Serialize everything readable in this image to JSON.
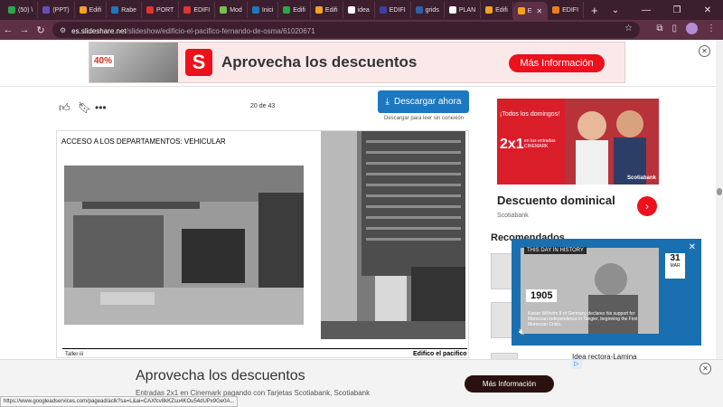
{
  "browser": {
    "tabs": [
      {
        "label": "(50) \\",
        "color": "#2aa84a"
      },
      {
        "label": "(PPT)",
        "color": "#6a4cc2"
      },
      {
        "label": "Edifi",
        "color": "#f2a31d"
      },
      {
        "label": "Rabe",
        "color": "#1c78c0"
      },
      {
        "label": "PORT",
        "color": "#e5322d"
      },
      {
        "label": "EDIFI",
        "color": "#e5322d"
      },
      {
        "label": "Mod",
        "color": "#7bbf4e"
      },
      {
        "label": "Inici",
        "color": "#1c78c0"
      },
      {
        "label": "Edifi",
        "color": "#2aa84a"
      },
      {
        "label": "Edifi",
        "color": "#f2a31d"
      },
      {
        "label": "idea",
        "color": "#ffffff"
      },
      {
        "label": "EDIFI",
        "color": "#3f3f9f"
      },
      {
        "label": "grids",
        "color": "#2f5fa7"
      },
      {
        "label": "PLAN",
        "color": "#ffffff"
      },
      {
        "label": "Edifi",
        "color": "#f2a31d"
      },
      {
        "label": "E",
        "color": "#f2a31d"
      },
      {
        "label": "EDIFI",
        "color": "#ef7d1a"
      }
    ],
    "active_tab_index": 15,
    "new_tab": "+",
    "url_host": "es.slideshare.net",
    "url_path": "/slideshow/edificio-el-pacifico-fernando-de-osma/61020671"
  },
  "top_ad": {
    "discount": "40%",
    "headline": "Aprovecha los descuentos",
    "cta": "Más Información",
    "close": "✕"
  },
  "doc": {
    "page_counter": "20 de 43",
    "download_label": "Descargar ahora",
    "download_sub": "Descargar para leer sin conexión",
    "slide_title": "ACCESO A LOS DEPARTAMENTOS: VEHICULAR",
    "footer_left": "Taller iii",
    "footer_right": "Edifico el pacifico"
  },
  "side_ad": {
    "line1": "¡Todos los domingos!",
    "big": "2x1",
    "small": "en tus entradas CINEMARK",
    "brand": "Scotiabank",
    "title": "Descuento dominical",
    "by": "Scotiabank",
    "arrow": "›"
  },
  "recommended": {
    "title": "Recomendados",
    "item_title": "Idea rectora-Lamina"
  },
  "video": {
    "tag": "THIS DAY IN HISTORY",
    "day": "31",
    "month": "MAR",
    "year": "1905",
    "caption": "Kaiser Wilhelm II of Germany declares his support for Moroccan independence in Tangier, beginning the First Moroccan Crisis.",
    "close": "✕"
  },
  "bottom_ad": {
    "headline": "Aprovecha los descuentos",
    "desc": "Entradas 2x1 en Cinemark pagando con Tarjetas Scotiabank, Scotiabank",
    "cta": "Más Información",
    "close": "✕"
  },
  "status_url": "https://www.googleadservices.com/pagead/aclk?sa=L&ai=CAXfcv8kKZsu4KOu54dUPx9Ge0A..."
}
